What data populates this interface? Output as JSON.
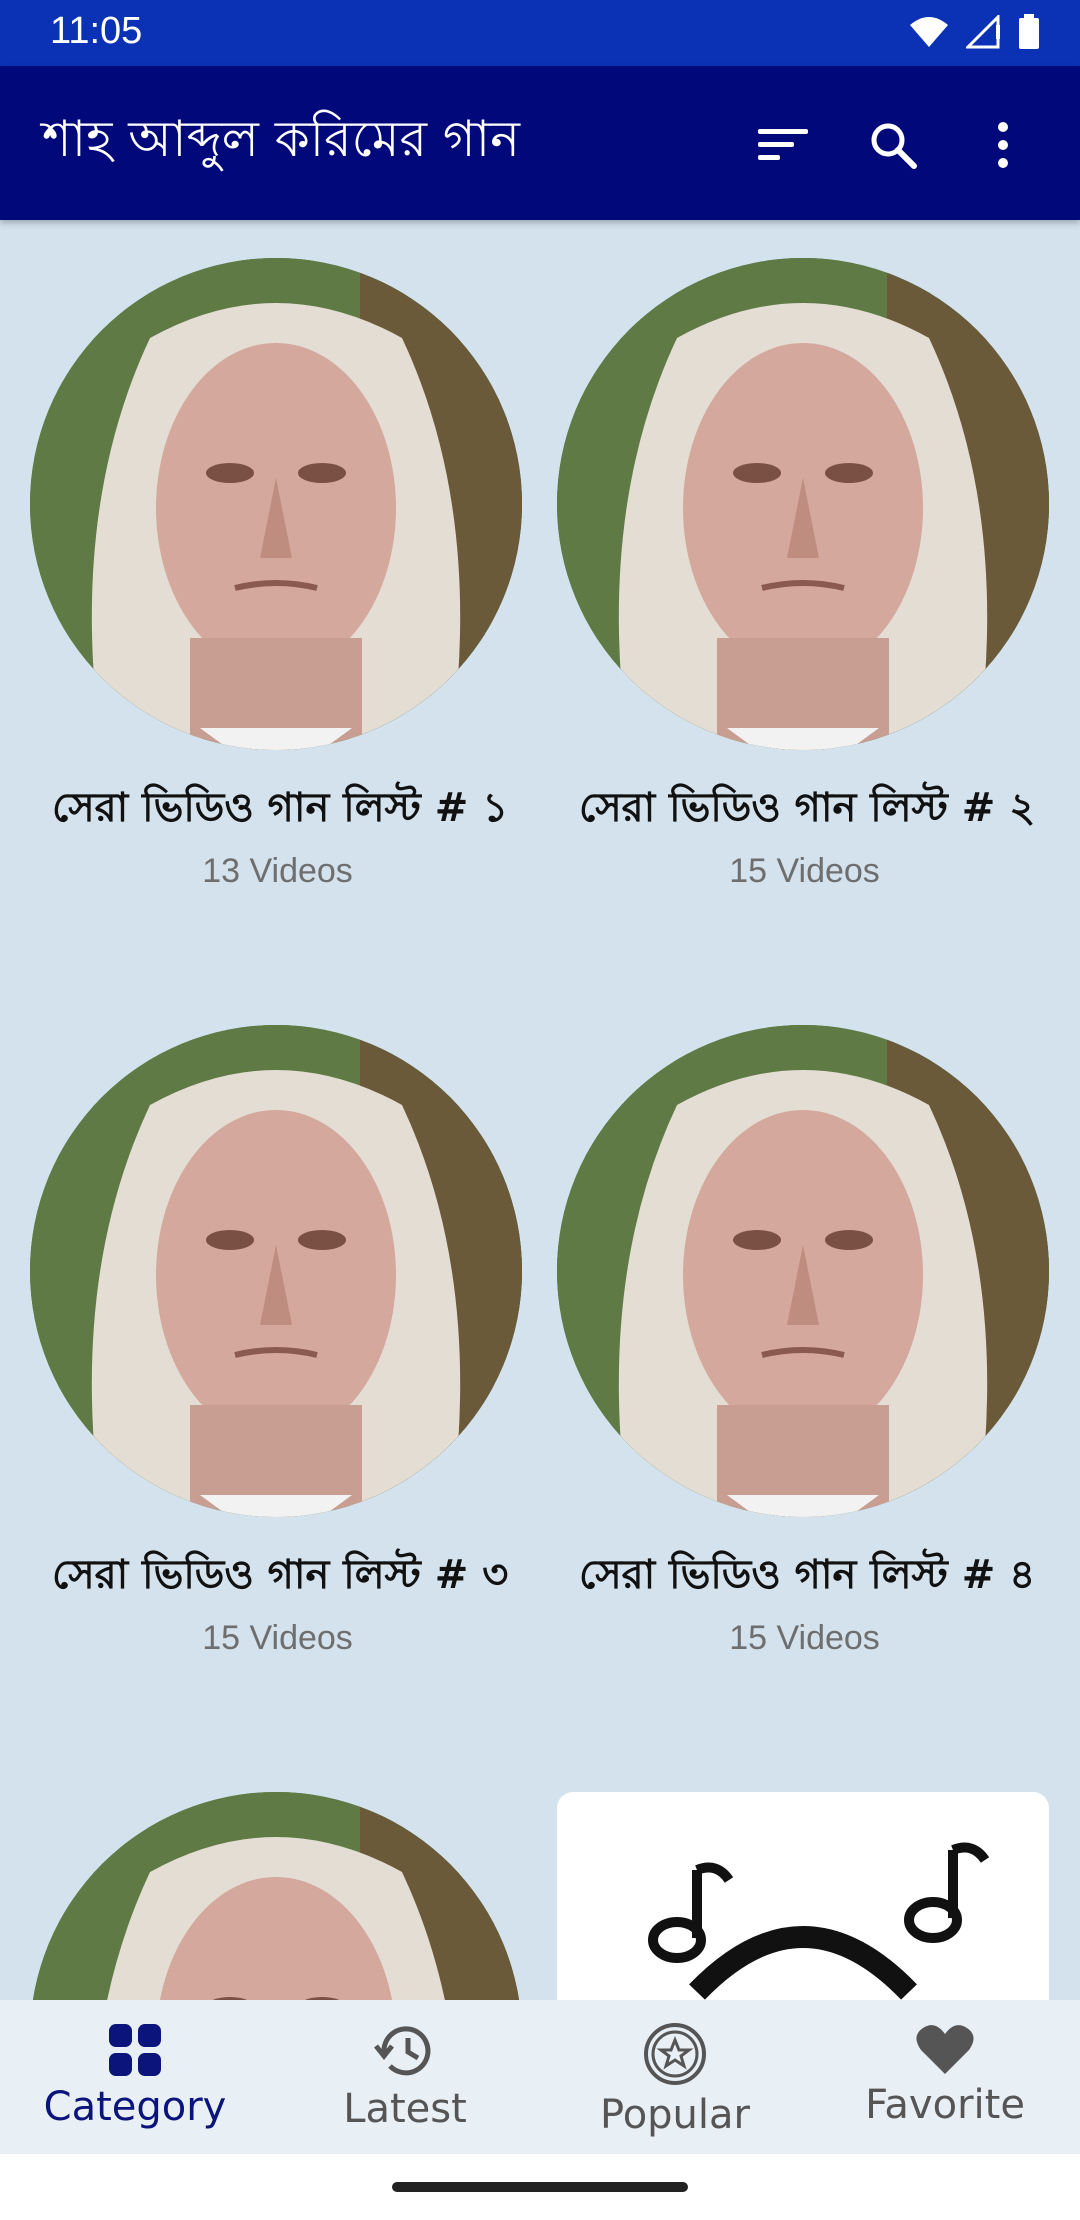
{
  "status_bar": {
    "time": "11:05"
  },
  "app_bar": {
    "title": "শাহ আব্দুল করিমের গান"
  },
  "categories": [
    {
      "title": "সেরা ভিডিও গান লিস্ট # ১",
      "count": "13 Videos"
    },
    {
      "title": "সেরা ভিডিও গান লিস্ট # ২",
      "count": "15 Videos"
    },
    {
      "title": "সেরা ভিডিও গান লিস্ট # ৩",
      "count": "15 Videos"
    },
    {
      "title": "সেরা ভিডিও গান লিস্ট # ৪",
      "count": "15 Videos"
    }
  ],
  "bottom_nav": [
    {
      "label": "Category",
      "icon": "grid-icon",
      "active": true
    },
    {
      "label": "Latest",
      "icon": "history-icon",
      "active": false
    },
    {
      "label": "Popular",
      "icon": "star-badge-icon",
      "active": false
    },
    {
      "label": "Favorite",
      "icon": "heart-icon",
      "active": false
    }
  ],
  "colors": {
    "status_bar": "#0b32b5",
    "app_bar": "#01097a",
    "background": "#d3e2ec",
    "nav_active": "#0a147a"
  }
}
